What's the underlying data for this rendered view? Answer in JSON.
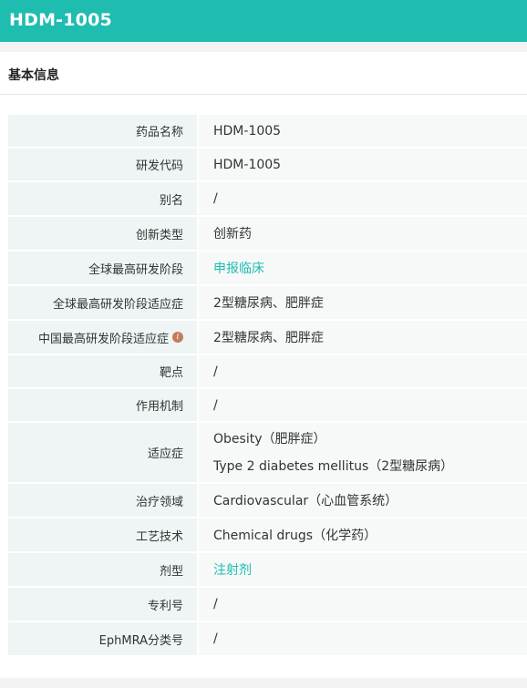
{
  "header": {
    "title": "HDM-1005"
  },
  "section": {
    "title": "基本信息"
  },
  "rows": [
    {
      "label": "药品名称",
      "value": "HDM-1005"
    },
    {
      "label": "研发代码",
      "value": "HDM-1005"
    },
    {
      "label": "别名",
      "value": "/"
    },
    {
      "label": "创新类型",
      "value": "创新药"
    },
    {
      "label": "全球最高研发阶段",
      "value": "申报临床",
      "link": true
    },
    {
      "label": "全球最高研发阶段适应症",
      "value": "2型糖尿病、肥胖症"
    },
    {
      "label": "中国最高研发阶段适应症",
      "value": "2型糖尿病、肥胖症",
      "info_icon": "info-icon"
    },
    {
      "label": "靶点",
      "value": "/"
    },
    {
      "label": "作用机制",
      "value": "/"
    },
    {
      "label": "适应症",
      "value": "Obesity（肥胖症）",
      "value2": "Type 2 diabetes mellitus（2型糖尿病）"
    },
    {
      "label": "治疗领域",
      "value": "Cardiovascular（心血管系统）"
    },
    {
      "label": "工艺技术",
      "value": "Chemical drugs（化学药）"
    },
    {
      "label": "剂型",
      "value": "注射剂",
      "link": true
    },
    {
      "label": "专利号",
      "value": "/"
    },
    {
      "label": "EphMRA分类号",
      "value": "/"
    }
  ],
  "colors": {
    "accent": "#1fbcb0",
    "label_bg": "#eef5f4",
    "value_bg": "#f7f9f9",
    "info_icon": "#c47b5a"
  }
}
